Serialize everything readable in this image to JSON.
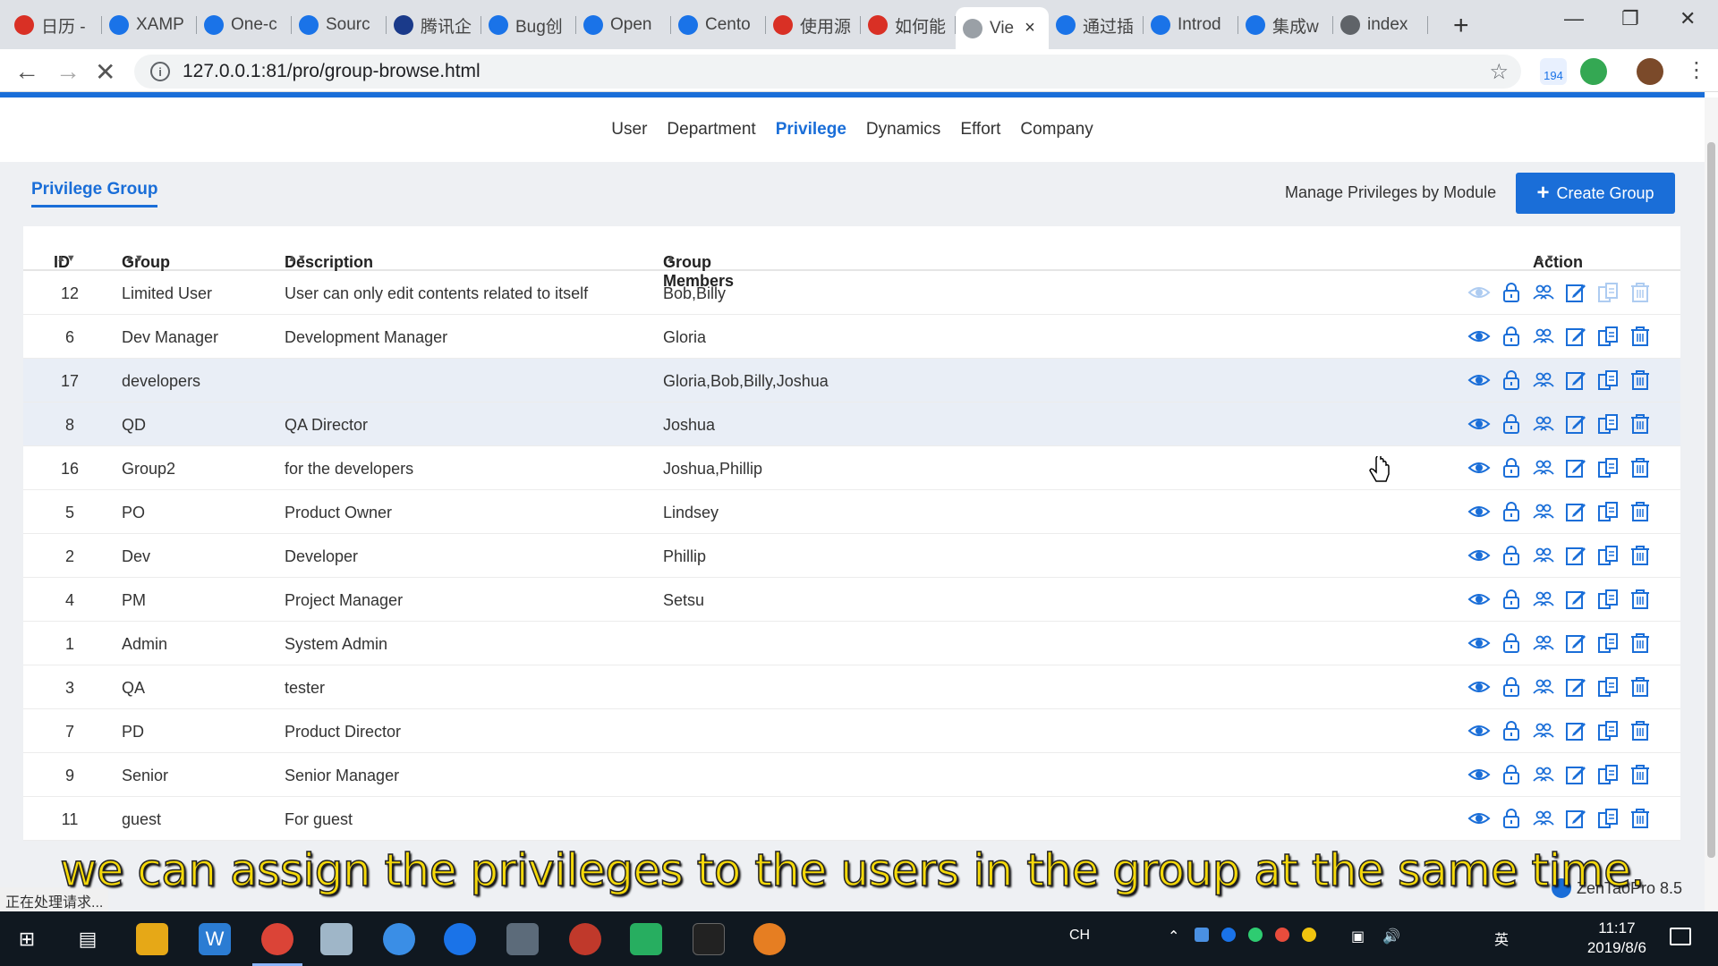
{
  "browser": {
    "tabs": [
      {
        "label": "日历 -",
        "color": "#d93025"
      },
      {
        "label": "XAMP",
        "color": "#1a73e8"
      },
      {
        "label": "One-c",
        "color": "#1a73e8"
      },
      {
        "label": "Sourc",
        "color": "#1a73e8"
      },
      {
        "label": "腾讯企",
        "color": "#1a3a8a"
      },
      {
        "label": "Bug创",
        "color": "#1a73e8"
      },
      {
        "label": "Open",
        "color": "#1a73e8"
      },
      {
        "label": "Cento",
        "color": "#1a73e8"
      },
      {
        "label": "使用源",
        "color": "#d93025"
      },
      {
        "label": "如何能",
        "color": "#d93025"
      },
      {
        "label": "Vie",
        "color": "#9aa0a6"
      },
      {
        "label": "通过插",
        "color": "#1a73e8"
      },
      {
        "label": "Introd",
        "color": "#1a73e8"
      },
      {
        "label": "集成w",
        "color": "#1a73e8"
      },
      {
        "label": "index",
        "color": "#5f6368"
      }
    ],
    "new_tab": "+",
    "url": "127.0.0.1:81/pro/group-browse.html",
    "badge": "194"
  },
  "subnav": {
    "items": [
      "User",
      "Department",
      "Privilege",
      "Dynamics",
      "Effort",
      "Company"
    ],
    "active": "Privilege"
  },
  "header": {
    "tab_label": "Privilege Group",
    "manage_link": "Manage Privileges by Module",
    "create_button": "Create Group",
    "create_plus": "+"
  },
  "table": {
    "columns": {
      "id": "ID",
      "group": "Group",
      "description": "Description",
      "members": "Group Members",
      "action": "Action"
    },
    "rows": [
      {
        "id": "12",
        "group": "Limited User",
        "description": "User can only edit contents related to itself",
        "members": "Bob,Billy"
      },
      {
        "id": "6",
        "group": "Dev Manager",
        "description": "Development Manager",
        "members": "Gloria"
      },
      {
        "id": "17",
        "group": "developers",
        "description": "",
        "members": "Gloria,Bob,Billy,Joshua"
      },
      {
        "id": "8",
        "group": "QD",
        "description": "QA Director",
        "members": "Joshua"
      },
      {
        "id": "16",
        "group": "Group2",
        "description": "for the developers",
        "members": "Joshua,Phillip"
      },
      {
        "id": "5",
        "group": "PO",
        "description": "Product Owner",
        "members": "Lindsey"
      },
      {
        "id": "2",
        "group": "Dev",
        "description": "Developer",
        "members": "Phillip"
      },
      {
        "id": "4",
        "group": "PM",
        "description": "Project Manager",
        "members": "Setsu"
      },
      {
        "id": "1",
        "group": "Admin",
        "description": "System Admin",
        "members": ""
      },
      {
        "id": "3",
        "group": "QA",
        "description": "tester",
        "members": ""
      },
      {
        "id": "7",
        "group": "PD",
        "description": "Product Director",
        "members": ""
      },
      {
        "id": "9",
        "group": "Senior",
        "description": "Senior Manager",
        "members": ""
      },
      {
        "id": "11",
        "group": "guest",
        "description": "For guest",
        "members": ""
      }
    ],
    "action_icons": [
      "eye-icon",
      "lock-icon",
      "users-icon",
      "edit-icon",
      "copy-icon",
      "trash-icon"
    ]
  },
  "footer": {
    "status": "正在处理请求...",
    "powered": "ZenTaoPro 8.5"
  },
  "subtitle": "we can assign the privileges to the users in the group at the same time.",
  "taskbar": {
    "ime": "CH",
    "lang": "英",
    "time": "11:17",
    "date": "2019/8/6"
  },
  "colors": {
    "accent": "#1a6ed8",
    "subtitle": "#f5d90a",
    "taskbar": "#101820"
  }
}
